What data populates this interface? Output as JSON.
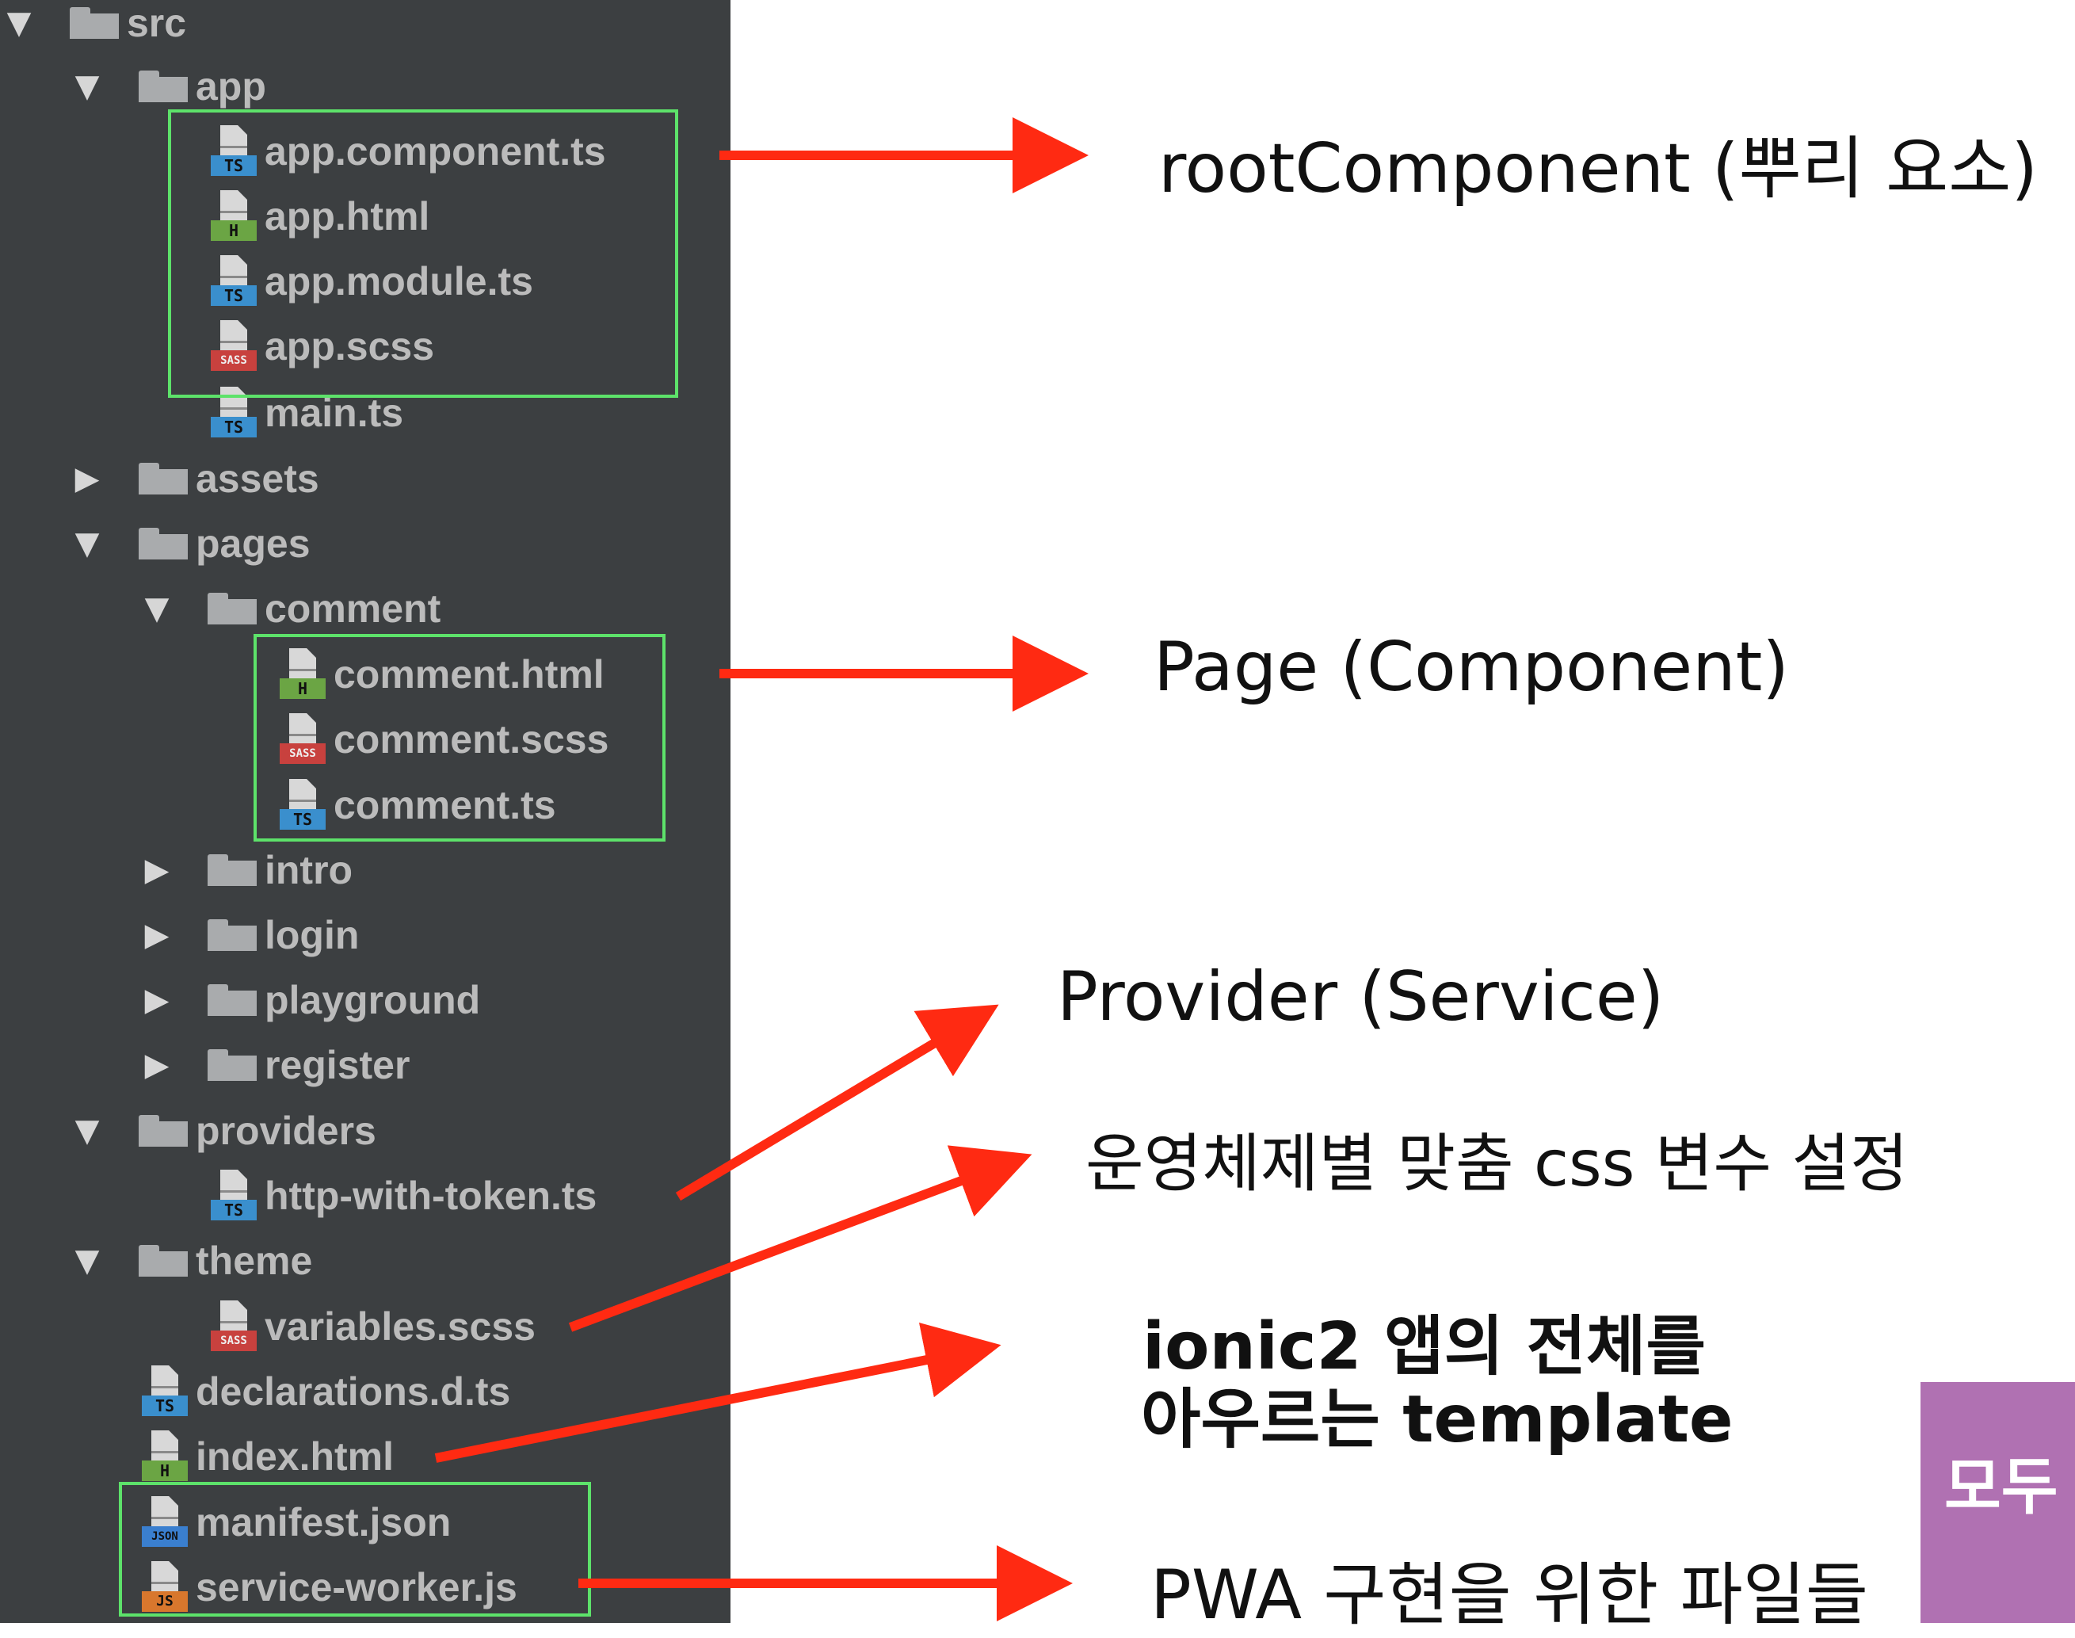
{
  "tree": [
    {
      "id": "src",
      "label": "src",
      "kind": "folder",
      "state": "open"
    },
    {
      "id": "app",
      "label": "app",
      "kind": "folder",
      "state": "open"
    },
    {
      "id": "app-component-ts",
      "label": "app.component.ts",
      "kind": "file",
      "badge": "TS"
    },
    {
      "id": "app-html",
      "label": "app.html",
      "kind": "file",
      "badge": "H"
    },
    {
      "id": "app-module-ts",
      "label": "app.module.ts",
      "kind": "file",
      "badge": "TS"
    },
    {
      "id": "app-scss",
      "label": "app.scss",
      "kind": "file",
      "badge": "SASS"
    },
    {
      "id": "main-ts",
      "label": "main.ts",
      "kind": "file",
      "badge": "TS"
    },
    {
      "id": "assets",
      "label": "assets",
      "kind": "folder",
      "state": "closed"
    },
    {
      "id": "pages",
      "label": "pages",
      "kind": "folder",
      "state": "open"
    },
    {
      "id": "comment",
      "label": "comment",
      "kind": "folder",
      "state": "open"
    },
    {
      "id": "comment-html",
      "label": "comment.html",
      "kind": "file",
      "badge": "H"
    },
    {
      "id": "comment-scss",
      "label": "comment.scss",
      "kind": "file",
      "badge": "SASS"
    },
    {
      "id": "comment-ts",
      "label": "comment.ts",
      "kind": "file",
      "badge": "TS"
    },
    {
      "id": "intro",
      "label": "intro",
      "kind": "folder",
      "state": "closed"
    },
    {
      "id": "login",
      "label": "login",
      "kind": "folder",
      "state": "closed"
    },
    {
      "id": "playground",
      "label": "playground",
      "kind": "folder",
      "state": "closed"
    },
    {
      "id": "register",
      "label": "register",
      "kind": "folder",
      "state": "closed"
    },
    {
      "id": "providers",
      "label": "providers",
      "kind": "folder",
      "state": "open"
    },
    {
      "id": "http-with-token-ts",
      "label": "http-with-token.ts",
      "kind": "file",
      "badge": "TS"
    },
    {
      "id": "theme",
      "label": "theme",
      "kind": "folder",
      "state": "open"
    },
    {
      "id": "variables-scss",
      "label": "variables.scss",
      "kind": "file",
      "badge": "SASS"
    },
    {
      "id": "declarations-d-ts",
      "label": "declarations.d.ts",
      "kind": "file",
      "badge": "TS"
    },
    {
      "id": "index-html",
      "label": "index.html",
      "kind": "file",
      "badge": "H"
    },
    {
      "id": "manifest-json",
      "label": "manifest.json",
      "kind": "file",
      "badge": "JSON"
    },
    {
      "id": "service-worker-js",
      "label": "service-worker.js",
      "kind": "file",
      "badge": "JS"
    }
  ],
  "annotations": {
    "root_component": "rootComponent (뿌리 요소)",
    "page": "Page (Component)",
    "provider": "Provider (Service)",
    "css_vars": "운영체제별 맞춤 css 변수 설정",
    "template_line1": "ionic2 앱의 전체를",
    "template_line2": "아우르는 template",
    "pwa": "PWA 구현을 위한 파일들"
  },
  "corner_badge": "모두",
  "colors": {
    "panel_bg": "#3c3f41",
    "highlight_box": "#5de26a",
    "arrow": "#ff2a12",
    "badge_bg": "#b071b2"
  }
}
